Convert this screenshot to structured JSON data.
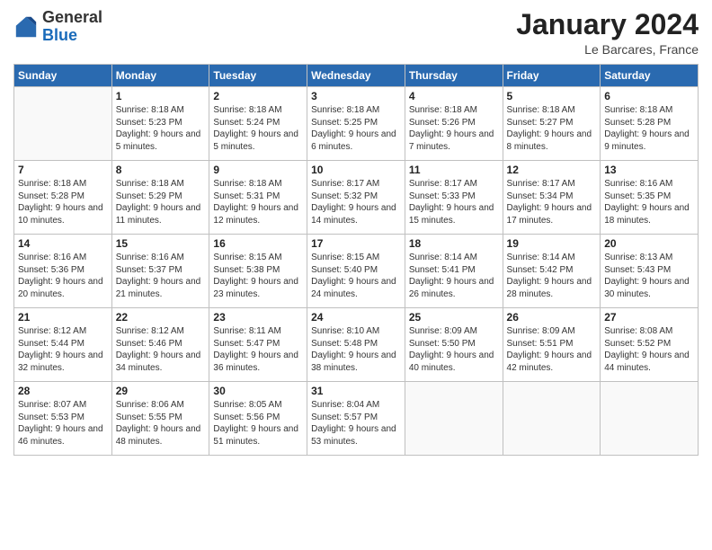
{
  "header": {
    "logo_general": "General",
    "logo_blue": "Blue",
    "month_title": "January 2024",
    "location": "Le Barcares, France"
  },
  "days_of_week": [
    "Sunday",
    "Monday",
    "Tuesday",
    "Wednesday",
    "Thursday",
    "Friday",
    "Saturday"
  ],
  "weeks": [
    [
      {
        "day": "",
        "empty": true
      },
      {
        "day": "1",
        "sunrise": "Sunrise: 8:18 AM",
        "sunset": "Sunset: 5:23 PM",
        "daylight": "Daylight: 9 hours and 5 minutes."
      },
      {
        "day": "2",
        "sunrise": "Sunrise: 8:18 AM",
        "sunset": "Sunset: 5:24 PM",
        "daylight": "Daylight: 9 hours and 5 minutes."
      },
      {
        "day": "3",
        "sunrise": "Sunrise: 8:18 AM",
        "sunset": "Sunset: 5:25 PM",
        "daylight": "Daylight: 9 hours and 6 minutes."
      },
      {
        "day": "4",
        "sunrise": "Sunrise: 8:18 AM",
        "sunset": "Sunset: 5:26 PM",
        "daylight": "Daylight: 9 hours and 7 minutes."
      },
      {
        "day": "5",
        "sunrise": "Sunrise: 8:18 AM",
        "sunset": "Sunset: 5:27 PM",
        "daylight": "Daylight: 9 hours and 8 minutes."
      },
      {
        "day": "6",
        "sunrise": "Sunrise: 8:18 AM",
        "sunset": "Sunset: 5:28 PM",
        "daylight": "Daylight: 9 hours and 9 minutes."
      }
    ],
    [
      {
        "day": "7",
        "sunrise": "Sunrise: 8:18 AM",
        "sunset": "Sunset: 5:28 PM",
        "daylight": "Daylight: 9 hours and 10 minutes."
      },
      {
        "day": "8",
        "sunrise": "Sunrise: 8:18 AM",
        "sunset": "Sunset: 5:29 PM",
        "daylight": "Daylight: 9 hours and 11 minutes."
      },
      {
        "day": "9",
        "sunrise": "Sunrise: 8:18 AM",
        "sunset": "Sunset: 5:31 PM",
        "daylight": "Daylight: 9 hours and 12 minutes."
      },
      {
        "day": "10",
        "sunrise": "Sunrise: 8:17 AM",
        "sunset": "Sunset: 5:32 PM",
        "daylight": "Daylight: 9 hours and 14 minutes."
      },
      {
        "day": "11",
        "sunrise": "Sunrise: 8:17 AM",
        "sunset": "Sunset: 5:33 PM",
        "daylight": "Daylight: 9 hours and 15 minutes."
      },
      {
        "day": "12",
        "sunrise": "Sunrise: 8:17 AM",
        "sunset": "Sunset: 5:34 PM",
        "daylight": "Daylight: 9 hours and 17 minutes."
      },
      {
        "day": "13",
        "sunrise": "Sunrise: 8:16 AM",
        "sunset": "Sunset: 5:35 PM",
        "daylight": "Daylight: 9 hours and 18 minutes."
      }
    ],
    [
      {
        "day": "14",
        "sunrise": "Sunrise: 8:16 AM",
        "sunset": "Sunset: 5:36 PM",
        "daylight": "Daylight: 9 hours and 20 minutes."
      },
      {
        "day": "15",
        "sunrise": "Sunrise: 8:16 AM",
        "sunset": "Sunset: 5:37 PM",
        "daylight": "Daylight: 9 hours and 21 minutes."
      },
      {
        "day": "16",
        "sunrise": "Sunrise: 8:15 AM",
        "sunset": "Sunset: 5:38 PM",
        "daylight": "Daylight: 9 hours and 23 minutes."
      },
      {
        "day": "17",
        "sunrise": "Sunrise: 8:15 AM",
        "sunset": "Sunset: 5:40 PM",
        "daylight": "Daylight: 9 hours and 24 minutes."
      },
      {
        "day": "18",
        "sunrise": "Sunrise: 8:14 AM",
        "sunset": "Sunset: 5:41 PM",
        "daylight": "Daylight: 9 hours and 26 minutes."
      },
      {
        "day": "19",
        "sunrise": "Sunrise: 8:14 AM",
        "sunset": "Sunset: 5:42 PM",
        "daylight": "Daylight: 9 hours and 28 minutes."
      },
      {
        "day": "20",
        "sunrise": "Sunrise: 8:13 AM",
        "sunset": "Sunset: 5:43 PM",
        "daylight": "Daylight: 9 hours and 30 minutes."
      }
    ],
    [
      {
        "day": "21",
        "sunrise": "Sunrise: 8:12 AM",
        "sunset": "Sunset: 5:44 PM",
        "daylight": "Daylight: 9 hours and 32 minutes."
      },
      {
        "day": "22",
        "sunrise": "Sunrise: 8:12 AM",
        "sunset": "Sunset: 5:46 PM",
        "daylight": "Daylight: 9 hours and 34 minutes."
      },
      {
        "day": "23",
        "sunrise": "Sunrise: 8:11 AM",
        "sunset": "Sunset: 5:47 PM",
        "daylight": "Daylight: 9 hours and 36 minutes."
      },
      {
        "day": "24",
        "sunrise": "Sunrise: 8:10 AM",
        "sunset": "Sunset: 5:48 PM",
        "daylight": "Daylight: 9 hours and 38 minutes."
      },
      {
        "day": "25",
        "sunrise": "Sunrise: 8:09 AM",
        "sunset": "Sunset: 5:50 PM",
        "daylight": "Daylight: 9 hours and 40 minutes."
      },
      {
        "day": "26",
        "sunrise": "Sunrise: 8:09 AM",
        "sunset": "Sunset: 5:51 PM",
        "daylight": "Daylight: 9 hours and 42 minutes."
      },
      {
        "day": "27",
        "sunrise": "Sunrise: 8:08 AM",
        "sunset": "Sunset: 5:52 PM",
        "daylight": "Daylight: 9 hours and 44 minutes."
      }
    ],
    [
      {
        "day": "28",
        "sunrise": "Sunrise: 8:07 AM",
        "sunset": "Sunset: 5:53 PM",
        "daylight": "Daylight: 9 hours and 46 minutes."
      },
      {
        "day": "29",
        "sunrise": "Sunrise: 8:06 AM",
        "sunset": "Sunset: 5:55 PM",
        "daylight": "Daylight: 9 hours and 48 minutes."
      },
      {
        "day": "30",
        "sunrise": "Sunrise: 8:05 AM",
        "sunset": "Sunset: 5:56 PM",
        "daylight": "Daylight: 9 hours and 51 minutes."
      },
      {
        "day": "31",
        "sunrise": "Sunrise: 8:04 AM",
        "sunset": "Sunset: 5:57 PM",
        "daylight": "Daylight: 9 hours and 53 minutes."
      },
      {
        "day": "",
        "empty": true
      },
      {
        "day": "",
        "empty": true
      },
      {
        "day": "",
        "empty": true
      }
    ]
  ]
}
